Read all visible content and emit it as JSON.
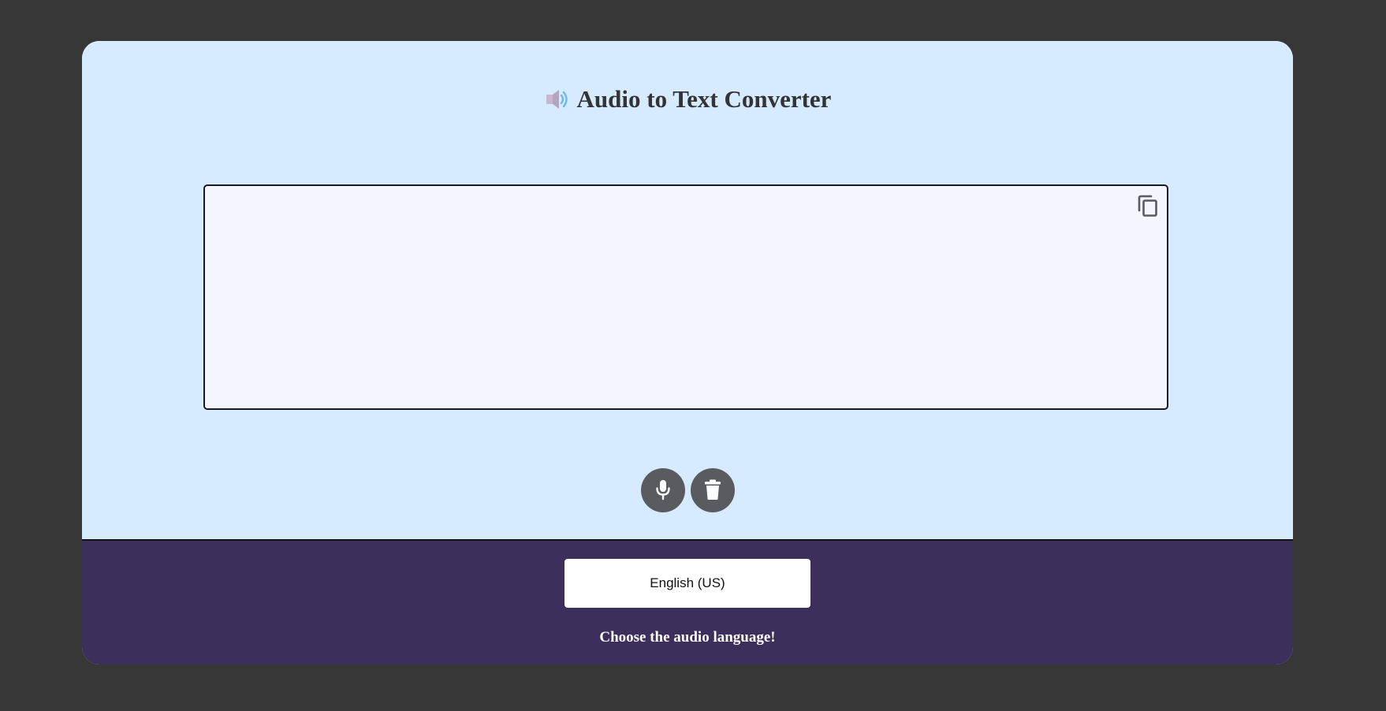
{
  "header": {
    "title": "Audio to Text Converter",
    "title_icon": "speaker-icon"
  },
  "transcript": {
    "value": "",
    "copy_icon": "copy-icon"
  },
  "controls": {
    "record_icon": "microphone-icon",
    "clear_icon": "trash-icon"
  },
  "footer": {
    "language_selected": "English (US)",
    "hint": "Choose the audio language!"
  },
  "colors": {
    "page_background": "#373737",
    "card_background": "#d6ebff",
    "textarea_background": "#f4f5ff",
    "footer_background": "#3c2f5c",
    "button_background": "#595b5e"
  }
}
